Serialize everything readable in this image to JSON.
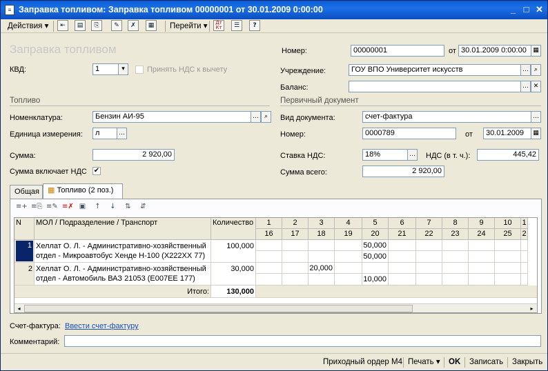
{
  "window": {
    "title": "Заправка топливом: Заправка топливом 00000001 от 30.01.2009 0:00:00"
  },
  "toolbar": {
    "actions_label": "Действия",
    "goto_label": "Перейти",
    "dt_kt_label": "Дт Кт"
  },
  "form": {
    "header_title": "Заправка топливом",
    "kvd_label": "КВД:",
    "kvd_value": "1",
    "vat_deduct_label": "Принять НДС к вычету",
    "number_label": "Номер:",
    "number_value": "00000001",
    "from_label": "от",
    "date_value": "30.01.2009  0:00:00",
    "institution_label": "Учреждение:",
    "institution_value": "ГОУ ВПО Университет искусств",
    "balance_label": "Баланс:",
    "balance_value": ""
  },
  "fuel": {
    "section_title": "Топливо",
    "nomenclature_label": "Номенклатура:",
    "nomenclature_value": "Бензин АИ-95",
    "unit_label": "Единица измерения:",
    "unit_value": "л",
    "sum_label": "Сумма:",
    "sum_value": "2 920,00",
    "sum_includes_vat_label": "Сумма включает НДС",
    "sum_includes_vat_checked": "✔"
  },
  "primary_doc": {
    "section_title": "Первичный документ",
    "doc_type_label": "Вид документа:",
    "doc_type_value": "счет-фактура",
    "number_label": "Номер:",
    "number_value": "0000789",
    "from_label": "от",
    "date_value": "30.01.2009",
    "vat_rate_label": "Ставка НДС:",
    "vat_rate_value": "18%",
    "vat_incl_label": "НДС (в т. ч.):",
    "vat_incl_value": "445,42",
    "total_label": "Сумма всего:",
    "total_value": "2 920,00"
  },
  "tabs": [
    {
      "label": "Общая"
    },
    {
      "label": "Топливо (2 поз.)"
    }
  ],
  "grid": {
    "headers": {
      "n": "N",
      "mol": "МОЛ / Подразделение / Транспорт",
      "qty": "Количество"
    },
    "day_cols": [
      {
        "top": "1",
        "bottom": "16"
      },
      {
        "top": "2",
        "bottom": "17"
      },
      {
        "top": "3",
        "bottom": "18"
      },
      {
        "top": "4",
        "bottom": "19"
      },
      {
        "top": "5",
        "bottom": "20"
      },
      {
        "top": "6",
        "bottom": "21"
      },
      {
        "top": "7",
        "bottom": "22"
      },
      {
        "top": "8",
        "bottom": "23"
      },
      {
        "top": "9",
        "bottom": "24"
      },
      {
        "top": "10",
        "bottom": "25"
      },
      {
        "top": "1",
        "bottom": "2"
      }
    ],
    "rows": [
      {
        "n": "1",
        "mol_line1": "Хеллат О. Л. - Административно-хозяйственный",
        "mol_line2": "отдел - Микроавтобус Хенде Н-100 (Х222ХХ 77)",
        "qty": "100,000",
        "c3_top": "",
        "c5_top": "50,000",
        "c5_bottom": "50,000"
      },
      {
        "n": "2",
        "mol_line1": "Хеллат О. Л. - Административно-хозяйственный",
        "mol_line2": "отдел - Автомобиль ВАЗ 21053 (Е007ЕЕ 177)",
        "qty": "30,000",
        "c3_top": "20,000",
        "c5_top": "",
        "c5_bottom": "10,000"
      }
    ],
    "total_label": "Итого:",
    "total_value": "130,000"
  },
  "footer": {
    "invoice_label": "Счет-фактура:",
    "invoice_link": "Ввести счет-фактуру",
    "comment_label": "Комментарий:",
    "comment_value": ""
  },
  "statusbar": {
    "receipt_order": "Приходный ордер М4",
    "print": "Печать",
    "ok": "OK",
    "save": "Записать",
    "close": "Закрыть"
  }
}
